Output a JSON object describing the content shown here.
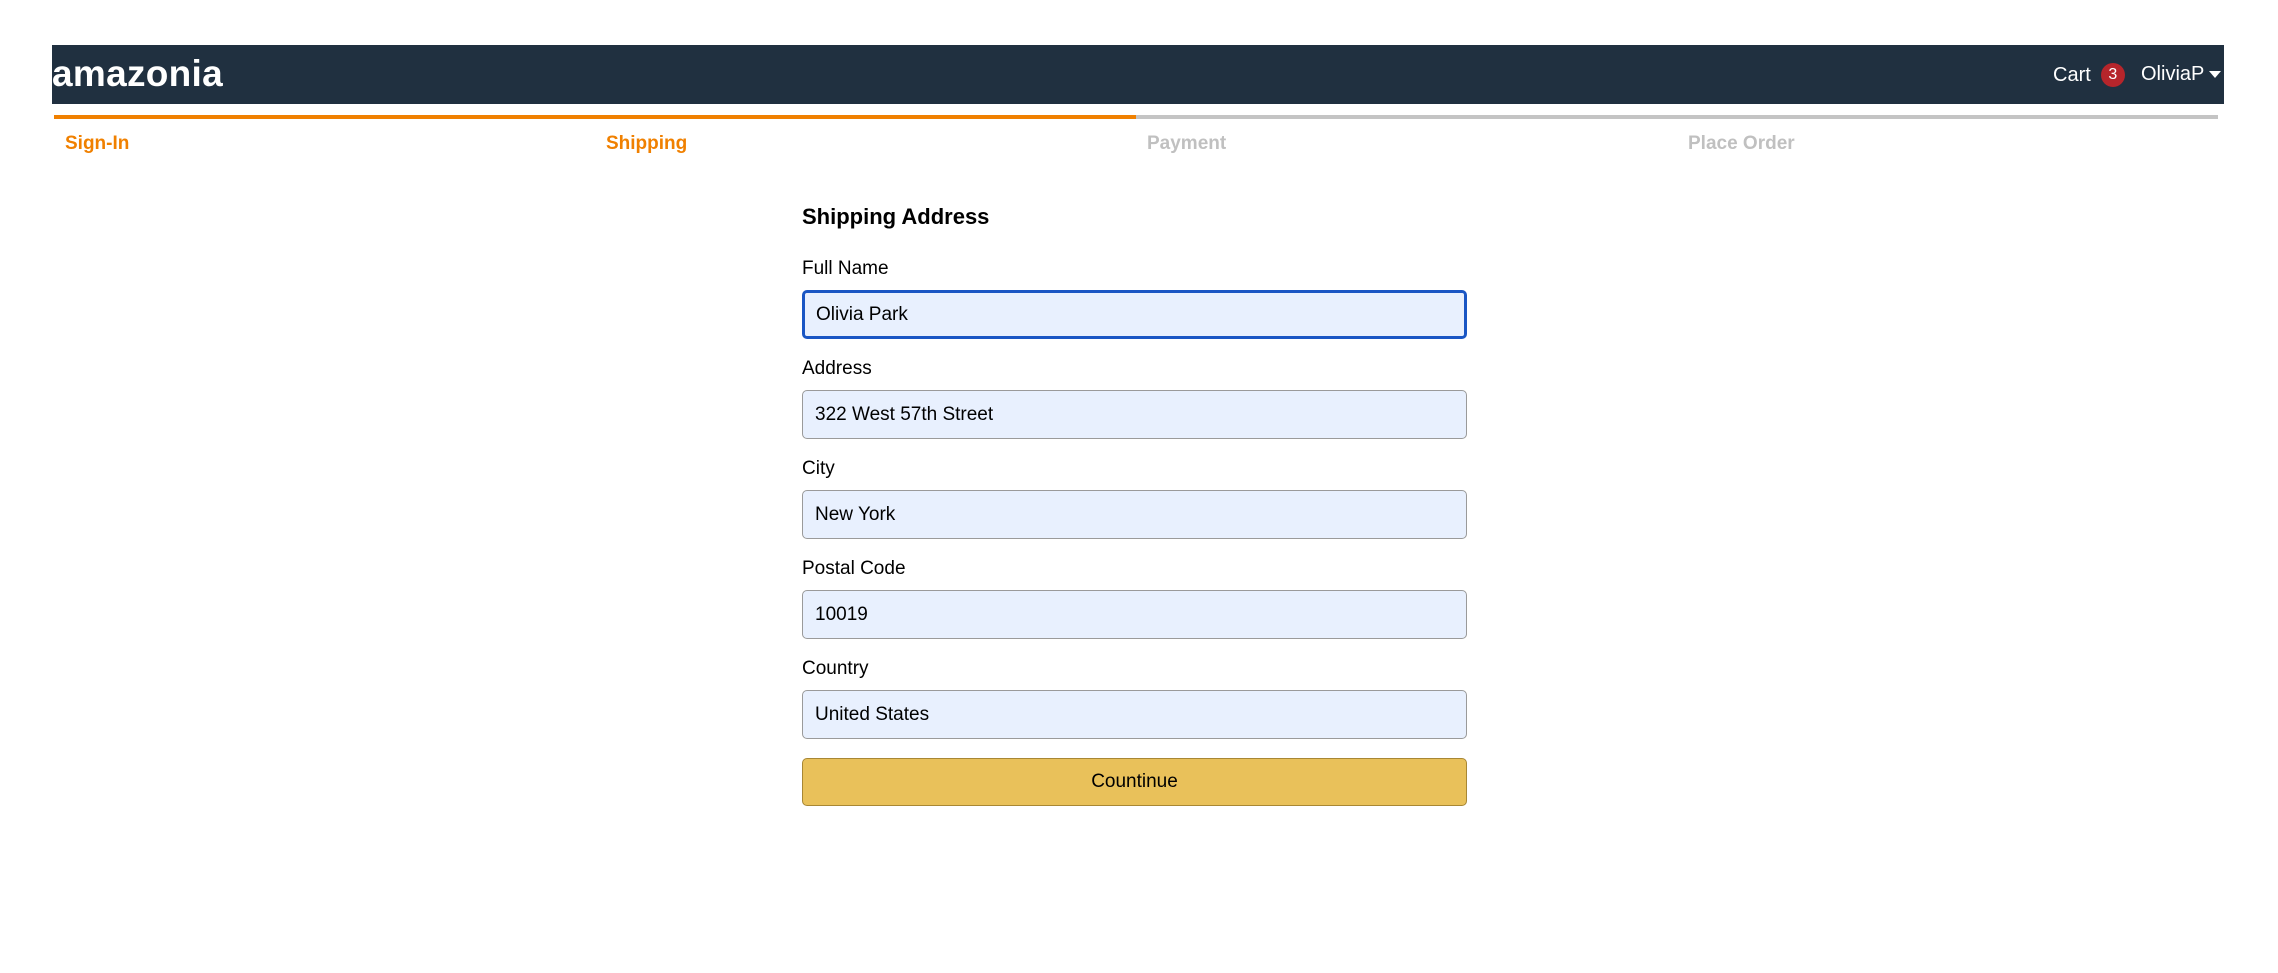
{
  "header": {
    "brand": "amazonia",
    "cart_label": "Cart",
    "cart_count": "3",
    "user_name": "OliviaP"
  },
  "steps": [
    {
      "label": "Sign-In",
      "active": true
    },
    {
      "label": "Shipping",
      "active": true
    },
    {
      "label": "Payment",
      "active": false
    },
    {
      "label": "Place Order",
      "active": false
    }
  ],
  "form": {
    "title": "Shipping Address",
    "fields": {
      "full_name": {
        "label": "Full Name",
        "value": "Olivia Park"
      },
      "address": {
        "label": "Address",
        "value": "322 West 57th Street"
      },
      "city": {
        "label": "City",
        "value": "New York"
      },
      "postal_code": {
        "label": "Postal Code",
        "value": "10019"
      },
      "country": {
        "label": "Country",
        "value": "United States"
      }
    },
    "submit_label": "Countinue"
  },
  "colors": {
    "header_bg": "#203040",
    "accent": "#f08000",
    "button_bg": "#e9c15a",
    "badge_bg": "#b6252b",
    "input_bg": "#e8f0fe"
  },
  "icons": {
    "user_menu": "caret-down-icon"
  }
}
